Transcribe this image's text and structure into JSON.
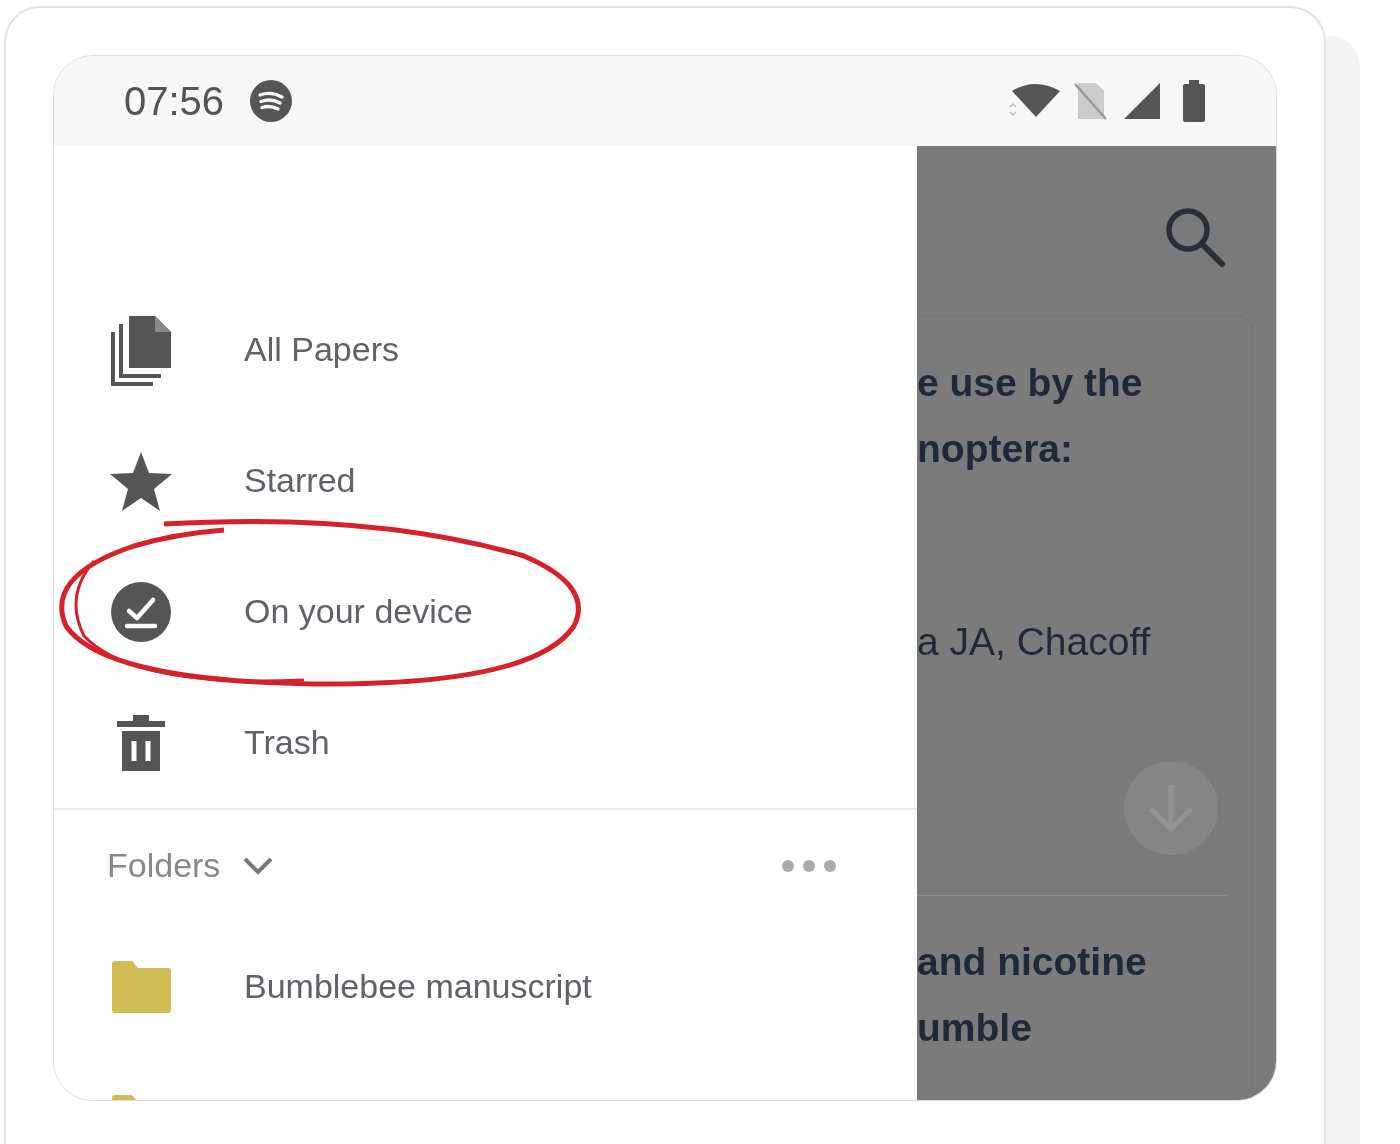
{
  "status_bar": {
    "time": "07:56"
  },
  "drawer": {
    "items": [
      {
        "kind": "papers",
        "label": "All Papers",
        "highlighted": false
      },
      {
        "kind": "star",
        "label": "Starred",
        "highlighted": false
      },
      {
        "kind": "device",
        "label": "On your device",
        "highlighted": true
      },
      {
        "kind": "trash",
        "label": "Trash",
        "highlighted": false
      }
    ],
    "folders_header": {
      "label": "Folders",
      "expanded": true
    },
    "folders": [
      {
        "label": "Bumblebee manuscript"
      }
    ],
    "more_folders_below": true
  },
  "background": {
    "items": [
      {
        "kind": "title",
        "lines": [
          "e use by the",
          "noptera:"
        ]
      },
      {
        "kind": "authors",
        "lines": [
          "a JA, Chacoff"
        ]
      },
      {
        "kind": "download"
      },
      {
        "kind": "divider"
      },
      {
        "kind": "title",
        "lines": [
          "and nicotine",
          "umble"
        ]
      }
    ]
  }
}
